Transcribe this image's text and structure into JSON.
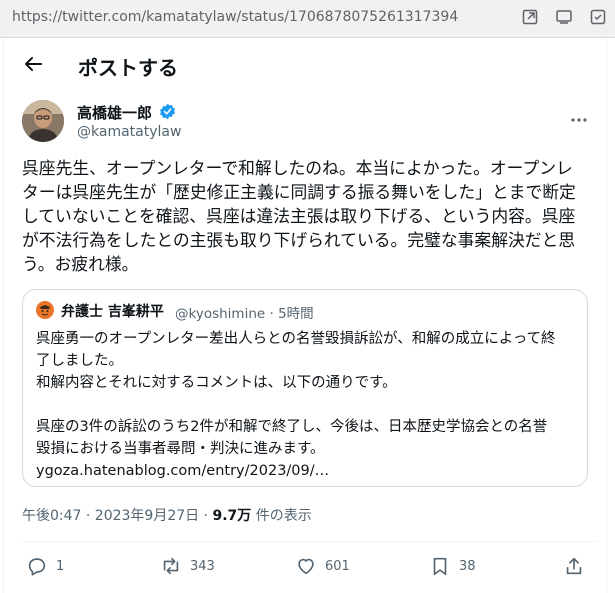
{
  "browser": {
    "url": "https://twitter.com/kamatatylaw/status/1706878075261317394"
  },
  "header": {
    "title": "ポストする"
  },
  "post": {
    "author_name": "高橋雄一郎",
    "author_handle": "@kamatatylaw",
    "text_lines": [
      "呉座先生、オープンレターで和解したのね。本当によかった。オープンレ",
      "ターは呉座先生が「歴史修正主義に同調する振る舞いをした」とまで断定",
      "していないことを確認、呉座は違法主張は取り下げる、という内容。呉座",
      "が不法行為をしたとの主張も取り下げられている。完璧な事案解決だと思",
      "う。お疲れ様。"
    ],
    "timestamp": "午後0:47 · 2023年9月27日 ·",
    "views_count": "9.7万",
    "views_label": "件の表示"
  },
  "quote": {
    "author_name": "弁護士 吉峯耕平",
    "author_handle": "@kyoshimine · 5時間",
    "text_lines": [
      "呉座勇一のオープンレター差出人らとの名誉毀損訴訟が、和解の成立によって終",
      "了しました。",
      "和解内容とそれに対するコメントは、以下の通りです。",
      "",
      "呉座の3件の訴訟のうち2件が和解で終了し、今後は、日本歴史学協会との名誉",
      "毀損における当事者尋問・判決に進みます。",
      "ygoza.hatenablog.com/entry/2023/09/…"
    ]
  },
  "actions": {
    "reply_count": "1",
    "repost_count": "343",
    "like_count": "601",
    "bookmark_count": "38"
  },
  "colors": {
    "verified": "#1d9bf0",
    "secondary_text": "#536471",
    "border": "#cfd9de"
  },
  "icons": [
    "back-arrow-icon",
    "verified-badge-icon",
    "more-icon",
    "reply-icon",
    "repost-icon",
    "like-icon",
    "bookmark-icon",
    "share-icon"
  ]
}
